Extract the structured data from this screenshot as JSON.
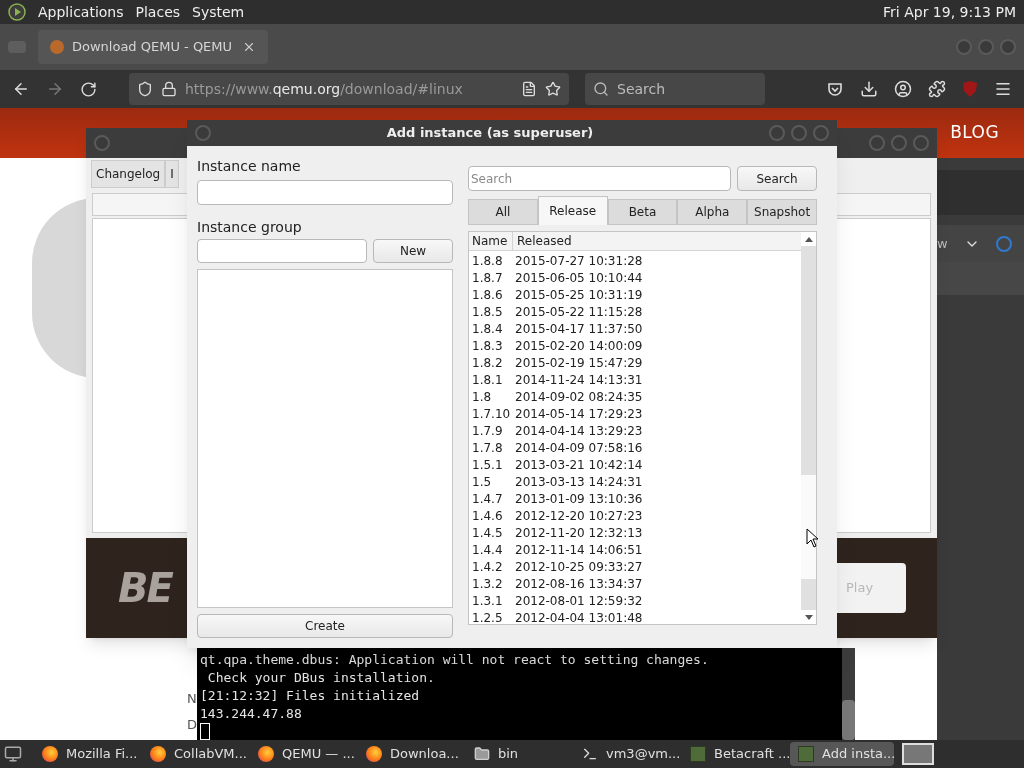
{
  "top_panel": {
    "menus": [
      "Applications",
      "Places",
      "System"
    ],
    "clock": "Fri Apr 19, 9:13 PM"
  },
  "browser": {
    "tabs": [
      {
        "title": "Download QEMU - QEMU",
        "selected": true
      }
    ],
    "url": {
      "prefix": "https://www.",
      "domain": "qemu.org",
      "path": "/download/#linux"
    },
    "search_placeholder": "Search",
    "page": {
      "nav_items": [
        "BLOG"
      ],
      "dropdown_fragment": "w",
      "edge_letters": [
        "N",
        "D"
      ]
    }
  },
  "betacraft": {
    "tabs": [
      {
        "label": "Changelog"
      },
      {
        "label": "I"
      }
    ],
    "logo": "BE",
    "play_button": "Play"
  },
  "dialog": {
    "title": "Add instance (as superuser)",
    "instance_name_label": "Instance name",
    "instance_group_label": "Instance group",
    "new_button": "New",
    "create_button": "Create",
    "search_placeholder": "Search",
    "search_button": "Search",
    "filter_tabs": [
      {
        "label": "All",
        "selected": false
      },
      {
        "label": "Release",
        "selected": true
      },
      {
        "label": "Beta",
        "selected": false
      },
      {
        "label": "Alpha",
        "selected": false
      },
      {
        "label": "Snapshot",
        "selected": false
      }
    ],
    "table": {
      "columns": [
        "Name",
        "Released"
      ],
      "rows": [
        {
          "name": "1.8.8",
          "released": "2015-07-27 10:31:28"
        },
        {
          "name": "1.8.7",
          "released": "2015-06-05 10:10:44"
        },
        {
          "name": "1.8.6",
          "released": "2015-05-25 10:31:19"
        },
        {
          "name": "1.8.5",
          "released": "2015-05-22 11:15:28"
        },
        {
          "name": "1.8.4",
          "released": "2015-04-17 11:37:50"
        },
        {
          "name": "1.8.3",
          "released": "2015-02-20 14:00:09"
        },
        {
          "name": "1.8.2",
          "released": "2015-02-19 15:47:29"
        },
        {
          "name": "1.8.1",
          "released": "2014-11-24 14:13:31"
        },
        {
          "name": "1.8",
          "released": "2014-09-02 08:24:35"
        },
        {
          "name": "1.7.10",
          "released": "2014-05-14 17:29:23"
        },
        {
          "name": "1.7.9",
          "released": "2014-04-14 13:29:23"
        },
        {
          "name": "1.7.8",
          "released": "2014-04-09 07:58:16"
        },
        {
          "name": "1.5.1",
          "released": "2013-03-21 10:42:14"
        },
        {
          "name": "1.5",
          "released": "2013-03-13 14:24:31"
        },
        {
          "name": "1.4.7",
          "released": "2013-01-09 13:10:36"
        },
        {
          "name": "1.4.6",
          "released": "2012-12-20 10:27:23"
        },
        {
          "name": "1.4.5",
          "released": "2012-11-20 12:32:13"
        },
        {
          "name": "1.4.4",
          "released": "2012-11-14 14:06:51"
        },
        {
          "name": "1.4.2",
          "released": "2012-10-25 09:33:27"
        },
        {
          "name": "1.3.2",
          "released": "2012-08-16 13:34:37"
        },
        {
          "name": "1.3.1",
          "released": "2012-08-01 12:59:32"
        },
        {
          "name": "1.2.5",
          "released": "2012-04-04 13:01:48"
        }
      ]
    }
  },
  "terminal": {
    "lines": [
      "qt.qpa.theme.dbus: Application will not react to setting changes.",
      " Check your DBus installation.",
      "[21:12:32] Files initialized",
      "143.244.47.88"
    ]
  },
  "taskbar": {
    "items": [
      {
        "label": "Mozilla Fi...",
        "kind": "browser",
        "selected": false
      },
      {
        "label": "CollabVM...",
        "kind": "browser",
        "selected": false
      },
      {
        "label": "QEMU — ...",
        "kind": "browser",
        "selected": false
      },
      {
        "label": "Downloa...",
        "kind": "browser",
        "selected": false
      },
      {
        "label": "bin",
        "kind": "folder",
        "selected": false
      },
      {
        "label": "vm3@vm...",
        "kind": "terminal",
        "selected": false
      },
      {
        "label": "Betacraft ...",
        "kind": "app",
        "selected": false
      },
      {
        "label": "Add insta...",
        "kind": "app",
        "selected": true
      }
    ]
  }
}
